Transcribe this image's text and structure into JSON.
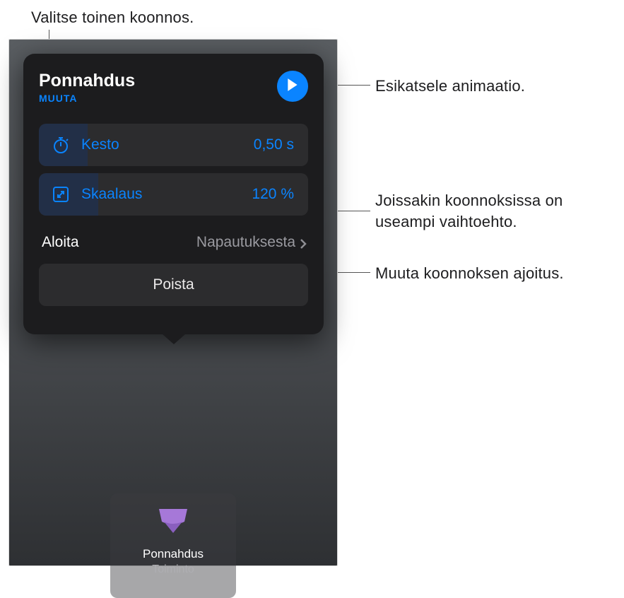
{
  "callouts": {
    "top": "Valitse toinen koonnos.",
    "preview": "Esikatsele animaatio.",
    "options": "Joissakin koonnoksissa on useampi vaihtoehto.",
    "timing": "Muuta koonnoksen ajoitus."
  },
  "popover": {
    "title": "Ponnahdus",
    "change_label": "MUUTA",
    "duration": {
      "label": "Kesto",
      "value": "0,50 s"
    },
    "scale": {
      "label": "Skaalaus",
      "value": "120 %"
    },
    "start": {
      "label": "Aloita",
      "value": "Napautuksesta"
    },
    "delete_label": "Poista"
  },
  "thumbnail": {
    "title": "Ponnahdus",
    "subtitle": "Toiminto"
  }
}
